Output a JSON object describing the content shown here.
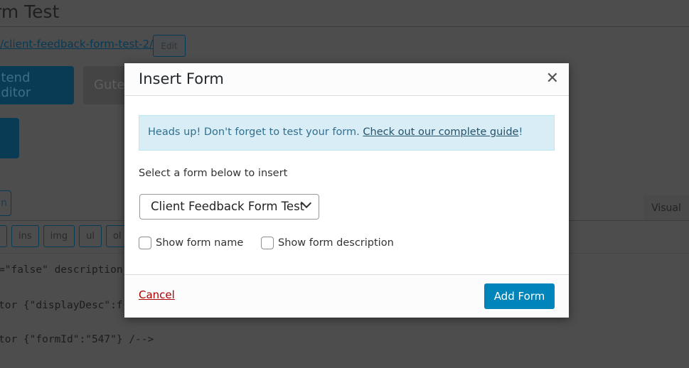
{
  "background": {
    "page_title": "rm Test",
    "permalink": "/client-feedback-form-test-2/",
    "edit_label": "Edit",
    "frontend_editor_label": "ntend Editor",
    "gutenberg_label": "Guten",
    "small_button_label": "n",
    "visual_tab": "Visual",
    "quicktags": [
      "ins",
      "img",
      "ul",
      "ol"
    ],
    "code_lines": [
      "=\"false\" description",
      "tor {\"displayDesc\":f",
      "tor {\"formId\":\"547\"} /-->"
    ]
  },
  "modal": {
    "title": "Insert Form",
    "close_icon": "close-icon",
    "notice_text": "Heads up! Don't forget to test your form. ",
    "notice_link": "Check out our complete guide",
    "notice_end": "!",
    "select_label": "Select a form below to insert",
    "selected_form": "Client Feedback Form Test",
    "show_name_label": "Show form name",
    "show_description_label": "Show form description",
    "show_name_checked": false,
    "show_description_checked": false,
    "cancel_label": "Cancel",
    "add_label": "Add Form"
  },
  "colors": {
    "primary": "#0085ba",
    "cancel": "#aa0000",
    "notice_bg": "#d9edf7"
  }
}
